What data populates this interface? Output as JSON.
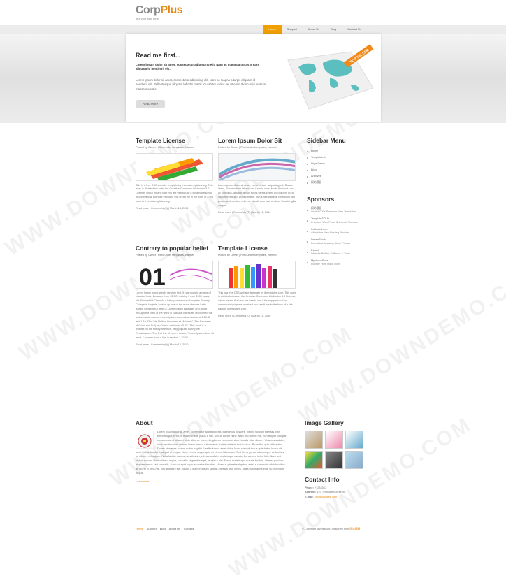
{
  "header": {
    "logo_a": "Corp",
    "logo_b": "Plus",
    "tagline": "put your logo here"
  },
  "menu": [
    "Home",
    "Support",
    "About Us",
    "Blog",
    "Contact Us"
  ],
  "hero": {
    "title": "Read me first...",
    "strong": "Lorem ipsum dolor sit amet, consectetur adipiscing elit. Nam ac magna a turpis ornare aliquam id hendrerit elit.",
    "text": "Lorem ipsum dolor sit amet, consectetur adipiscing elit. Nam ac magna a turpis aliquam id hendrerit elit. Pellentesque aliquam lobortis mattis. Curabitur varius vel ut enim rhoncus id pretium massa molestie.",
    "button": "Read More",
    "badge": "TOP SELLER"
  },
  "posts": [
    {
      "title": "Template License",
      "meta": "Posted by Owner | Filed under templates, internet",
      "text": "This is a free CSS website template by freecsstemplates.org. This work is distributed under the Creative Commons Attribution 3.0 License, which means that you are free to use it for any personal or commercial purpose provided you credit me in the form of a link back to freecsstemplates.org.",
      "foot": "Read more | Comments (3) | March 14, 2010"
    },
    {
      "title": "Lorem Ipsum Dolor Sit",
      "meta": "Posted by Owner | Filed under templates, internet",
      "text": "Lorem ipsum dolor sit amet, consectetuer adipiscing elit. Donec libero. Suspendisse bibendum. Cras id urna. Morbi tincidunt, orci ac convallis aliquam, lectus turpis varius lorem, eu posuere nunc justo tempus leo. Donec mattis, purus nec placerat bibendum, dui pede condimentum odio, ac blandit ante orci ut diam. Cras fringilla magna.",
      "foot": "Read more | Comments (7) | March 15, 2010"
    },
    {
      "title": "Contrary to popular belief",
      "meta": "Posted by Owner | Filed under templates, internet",
      "text": "Lorem Ipsum is not simply random text. It has roots in a piece of classical Latin literature from 45 BC, making it over 2000 years old. Richard McClintock, a Latin professor at Hampden-Sydney College in Virginia, looked up one of the more obscure Latin words, consectetur, from a Lorem Ipsum passage, and going through the cites of the word in classical literature, discovered the undoubtable source. Lorem Ipsum comes from sections 1.10.32 and 1.10.33 of \"de Finibus Bonorum et Malorum\" (The Extremes of Good and Evil) by Cicero, written in 45 BC. This book is a treatise on the theory of ethics, very popular during the Renaissance. The first line of Lorem Ipsum, \"Lorem ipsum dolor sit amet..\", comes from a line in section 1.10.32.",
      "foot": "Read more | Comments (0) | March 14, 2010"
    },
    {
      "title": "Template License",
      "meta": "Posted by Owner | Filed under templates, internet",
      "text": "This is a free CSS website template by 8templates.com. This work is distributed under the Creative Commons Attribution 3.0 License, which means that you are free to use it for any personal or commercial purpose provided you credit me in the form of a link back to 8templates.com.",
      "foot": "Read more | Comments (0) | March 15, 2010"
    }
  ],
  "sidebar": {
    "menu_title": "Sidebar Menu",
    "menu": [
      "Home",
      "Templateinfo",
      "Style Demo",
      "Blog",
      "Archives",
      "网站模板"
    ],
    "sponsors_title": "Sponsors",
    "sponsors": [
      {
        "name": "网站模板",
        "desc": "Over 6,000+ Premium Web Templates"
      },
      {
        "name": "TemplateSOLD",
        "desc": "Premium WordPress & Joomla Themes"
      },
      {
        "name": "ImHosted.com",
        "desc": "Affordable Web Hosting Provider"
      },
      {
        "name": "DreamStock",
        "desc": "Download Amazing Stock Photos"
      },
      {
        "name": "Evrsoft",
        "desc": "Website Builder Software & Tools"
      },
      {
        "name": "MyVectorStore",
        "desc": "Royalty Free Stock Icons"
      }
    ]
  },
  "about": {
    "title": "About",
    "text": "Lorem ipsum dolor sit amet, consectetur adipiscing elit. Maecenas posuere, nibh id suscipit egestas, felis tortor feugiat tortor, in euismod erat purus a nisl. Sed at auctor nunc. Nam nisl rutrum nisi, non feugiat volutpat consectetur ut sit amet nibh. Ut ante lorem, fringilla eu commodo vitae, iaculis vitae dictum. Vivamus sodales, urna nec tincidunt cursus, lorem massa rutrum arcu, luctus volutpat erat in risus. Phasellus quis nibh enim. Donec ut massa ac erat mattis sagittis. Vestibulum ut amet dolor. Nunc suscipit lectus quis tortor, luctus sit amet luctus tincidunt, aliquet et neque. Nunc viverra augue quis mi viverra bibendum. Sed libero purus, ullamcorper ac facilisis in, ultrices vel sapien. Nulla facilisi. Aenean vestibulum, elit nec sodales scelerisque mauris. Donec nec tortor felis. Nam sed lacinia mauris. Donec libero augue, convallis ut gravida eget, feugiat a nisl. Fusce scelerisque mauris facilisis. Integer pulvinar aliquam metus sed convallis. Nam volutpat turpis ac metus tincidunt. Vivamus pharetra dapibus ante, a commodo nibh faucibus at. Morbi in urna nisi, nec tincidunt elit. Mauris a diam in ipsum sagittis egestas ut in lorem. Nulla non magna erat, eu bibendum neque.",
    "more": "Learn more..."
  },
  "gallery": {
    "title": "Image Gallery"
  },
  "contact": {
    "title": "Contact Info",
    "phone_label": "Phone:",
    "phone": "+1234567",
    "address_label": "Address:",
    "address": "123 TemplateAccess Rd",
    "email_label": "E-mail:",
    "email": "info@yourweb.com"
  },
  "footer": {
    "links": [
      "Home",
      "Support",
      "Blog",
      "About Us",
      "Contact"
    ],
    "copy": "© Copyright MyWebSite. Designed from ",
    "copy_link": "网站模板"
  },
  "watermark": "WWW.DOWNDEMO.COM",
  "colors": {
    "accent": "#e8850c",
    "menu_active": "#f0a000"
  }
}
